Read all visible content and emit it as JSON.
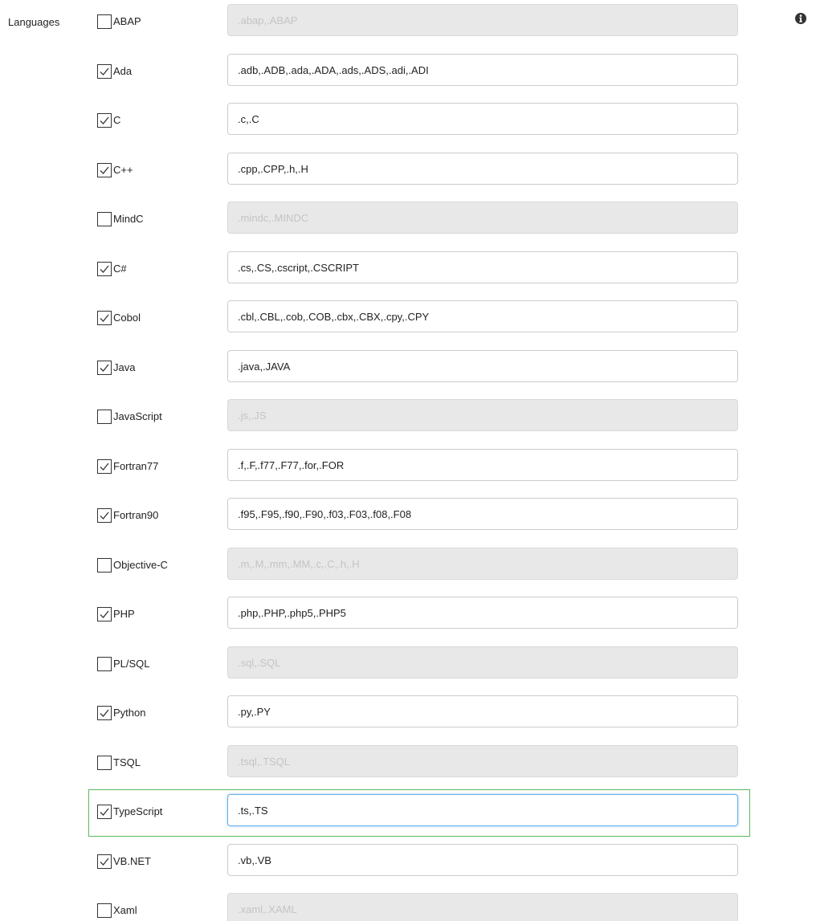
{
  "section_label": "Languages",
  "info_icon": "info-circle-icon",
  "colors": {
    "highlight_border": "#5cb85c",
    "disabled_input_bg": "#e8e8e8",
    "focus_border": "#66afe9"
  },
  "languages": [
    {
      "name": "ABAP",
      "checked": false,
      "extensions": ".abap,.ABAP"
    },
    {
      "name": "Ada",
      "checked": true,
      "extensions": ".adb,.ADB,.ada,.ADA,.ads,.ADS,.adi,.ADI"
    },
    {
      "name": "C",
      "checked": true,
      "extensions": ".c,.C"
    },
    {
      "name": "C++",
      "checked": true,
      "extensions": ".cpp,.CPP,.h,.H"
    },
    {
      "name": "MindC",
      "checked": false,
      "extensions": ".mindc,.MINDC"
    },
    {
      "name": "C#",
      "checked": true,
      "extensions": ".cs,.CS,.cscript,.CSCRIPT"
    },
    {
      "name": "Cobol",
      "checked": true,
      "extensions": ".cbl,.CBL,.cob,.COB,.cbx,.CBX,.cpy,.CPY"
    },
    {
      "name": "Java",
      "checked": true,
      "extensions": ".java,.JAVA"
    },
    {
      "name": "JavaScript",
      "checked": false,
      "extensions": ".js,.JS"
    },
    {
      "name": "Fortran77",
      "checked": true,
      "extensions": ".f,.F,.f77,.F77,.for,.FOR"
    },
    {
      "name": "Fortran90",
      "checked": true,
      "extensions": ".f95,.F95,.f90,.F90,.f03,.F03,.f08,.F08"
    },
    {
      "name": "Objective-C",
      "checked": false,
      "extensions": ".m,.M,.mm,.MM,.c,.C,.h,.H"
    },
    {
      "name": "PHP",
      "checked": true,
      "extensions": ".php,.PHP,.php5,.PHP5"
    },
    {
      "name": "PL/SQL",
      "checked": false,
      "extensions": ".sql,.SQL"
    },
    {
      "name": "Python",
      "checked": true,
      "extensions": ".py,.PY"
    },
    {
      "name": "TSQL",
      "checked": false,
      "extensions": ".tsql,.TSQL"
    },
    {
      "name": "TypeScript",
      "checked": true,
      "extensions": ".ts,.TS",
      "highlighted": true,
      "focused": true
    },
    {
      "name": "VB.NET",
      "checked": true,
      "extensions": ".vb,.VB"
    },
    {
      "name": "Xaml",
      "checked": false,
      "extensions": ".xaml,.XAML"
    }
  ]
}
